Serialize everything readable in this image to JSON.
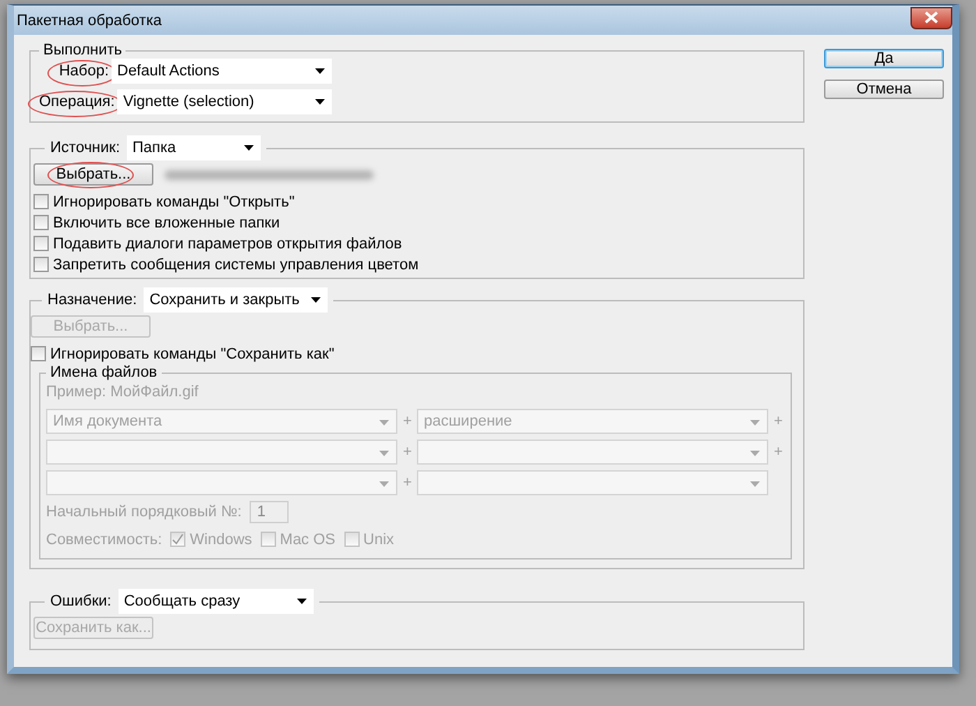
{
  "window": {
    "title": "Пакетная обработка"
  },
  "play": {
    "legend": "Выполнить",
    "fields": [
      {
        "label": "Набор:",
        "value": "Default Actions",
        "circled": true
      },
      {
        "label": "Операция:",
        "value": "Vignette (selection)",
        "circled": true
      }
    ]
  },
  "source": {
    "label": "Источник:",
    "value": "Папка",
    "choose_button": {
      "label": "Выбрать...",
      "disabled": false,
      "circled": true
    },
    "options": [
      {
        "label": "Игнорировать команды \"Открыть\"",
        "checked": false
      },
      {
        "label": "Включить все вложенные папки",
        "checked": false
      },
      {
        "label": "Подавить диалоги параметров открытия файлов",
        "checked": false
      },
      {
        "label": "Запретить сообщения системы управления цветом",
        "checked": false
      }
    ]
  },
  "destination": {
    "label": "Назначение:",
    "value": "Сохранить и закрыть",
    "choose_button": {
      "label": "Выбрать...",
      "disabled": true
    },
    "options": [
      {
        "label": "Игнорировать команды \"Сохранить как\"",
        "checked": false
      }
    ],
    "file_naming": {
      "legend": "Имена файлов",
      "disabled": true,
      "example": "Пример: МойФайл.gif",
      "rows": [
        {
          "left": "Имя документа",
          "plus_1": "+",
          "right": "расширение",
          "plus_2": "+"
        },
        {
          "plus_1": "+",
          "plus_2": "+"
        },
        {
          "plus_1": "+"
        }
      ],
      "serial": {
        "label": "Начальный порядковый №:",
        "value": "1"
      },
      "compat": {
        "label": "Совместимость:",
        "options": [
          {
            "label": "Windows",
            "checked": true
          },
          {
            "label": "Mac OS",
            "checked": false
          },
          {
            "label": "Unix",
            "checked": false
          }
        ]
      }
    }
  },
  "errors": {
    "label": "Ошибки:",
    "value": "Сообщать сразу",
    "save_button": {
      "label": "Сохранить как...",
      "disabled": true
    }
  },
  "buttons": [
    {
      "label": "Да",
      "default": true
    },
    {
      "label": "Отмена",
      "default": false
    }
  ]
}
